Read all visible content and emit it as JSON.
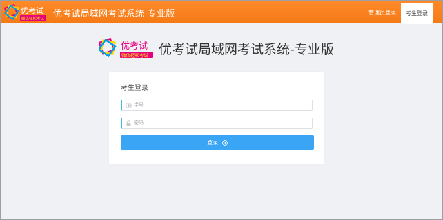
{
  "header": {
    "logo_text": "优考试",
    "logo_tagline": "微信轻松考试",
    "title": "优考试局域网考试系统-专业版",
    "nav": {
      "admin_login": "管理员登录",
      "student_login": "考生登录"
    }
  },
  "hero": {
    "title": "优考试局域网考试系统-专业版"
  },
  "login_card": {
    "title": "考生登录",
    "username_placeholder": "学号",
    "password_placeholder": "密码",
    "submit_label": "登录"
  },
  "colors": {
    "header_orange": "#f47a15",
    "button_blue": "#3ba5f5",
    "field_accent": "#3bbfd6"
  }
}
